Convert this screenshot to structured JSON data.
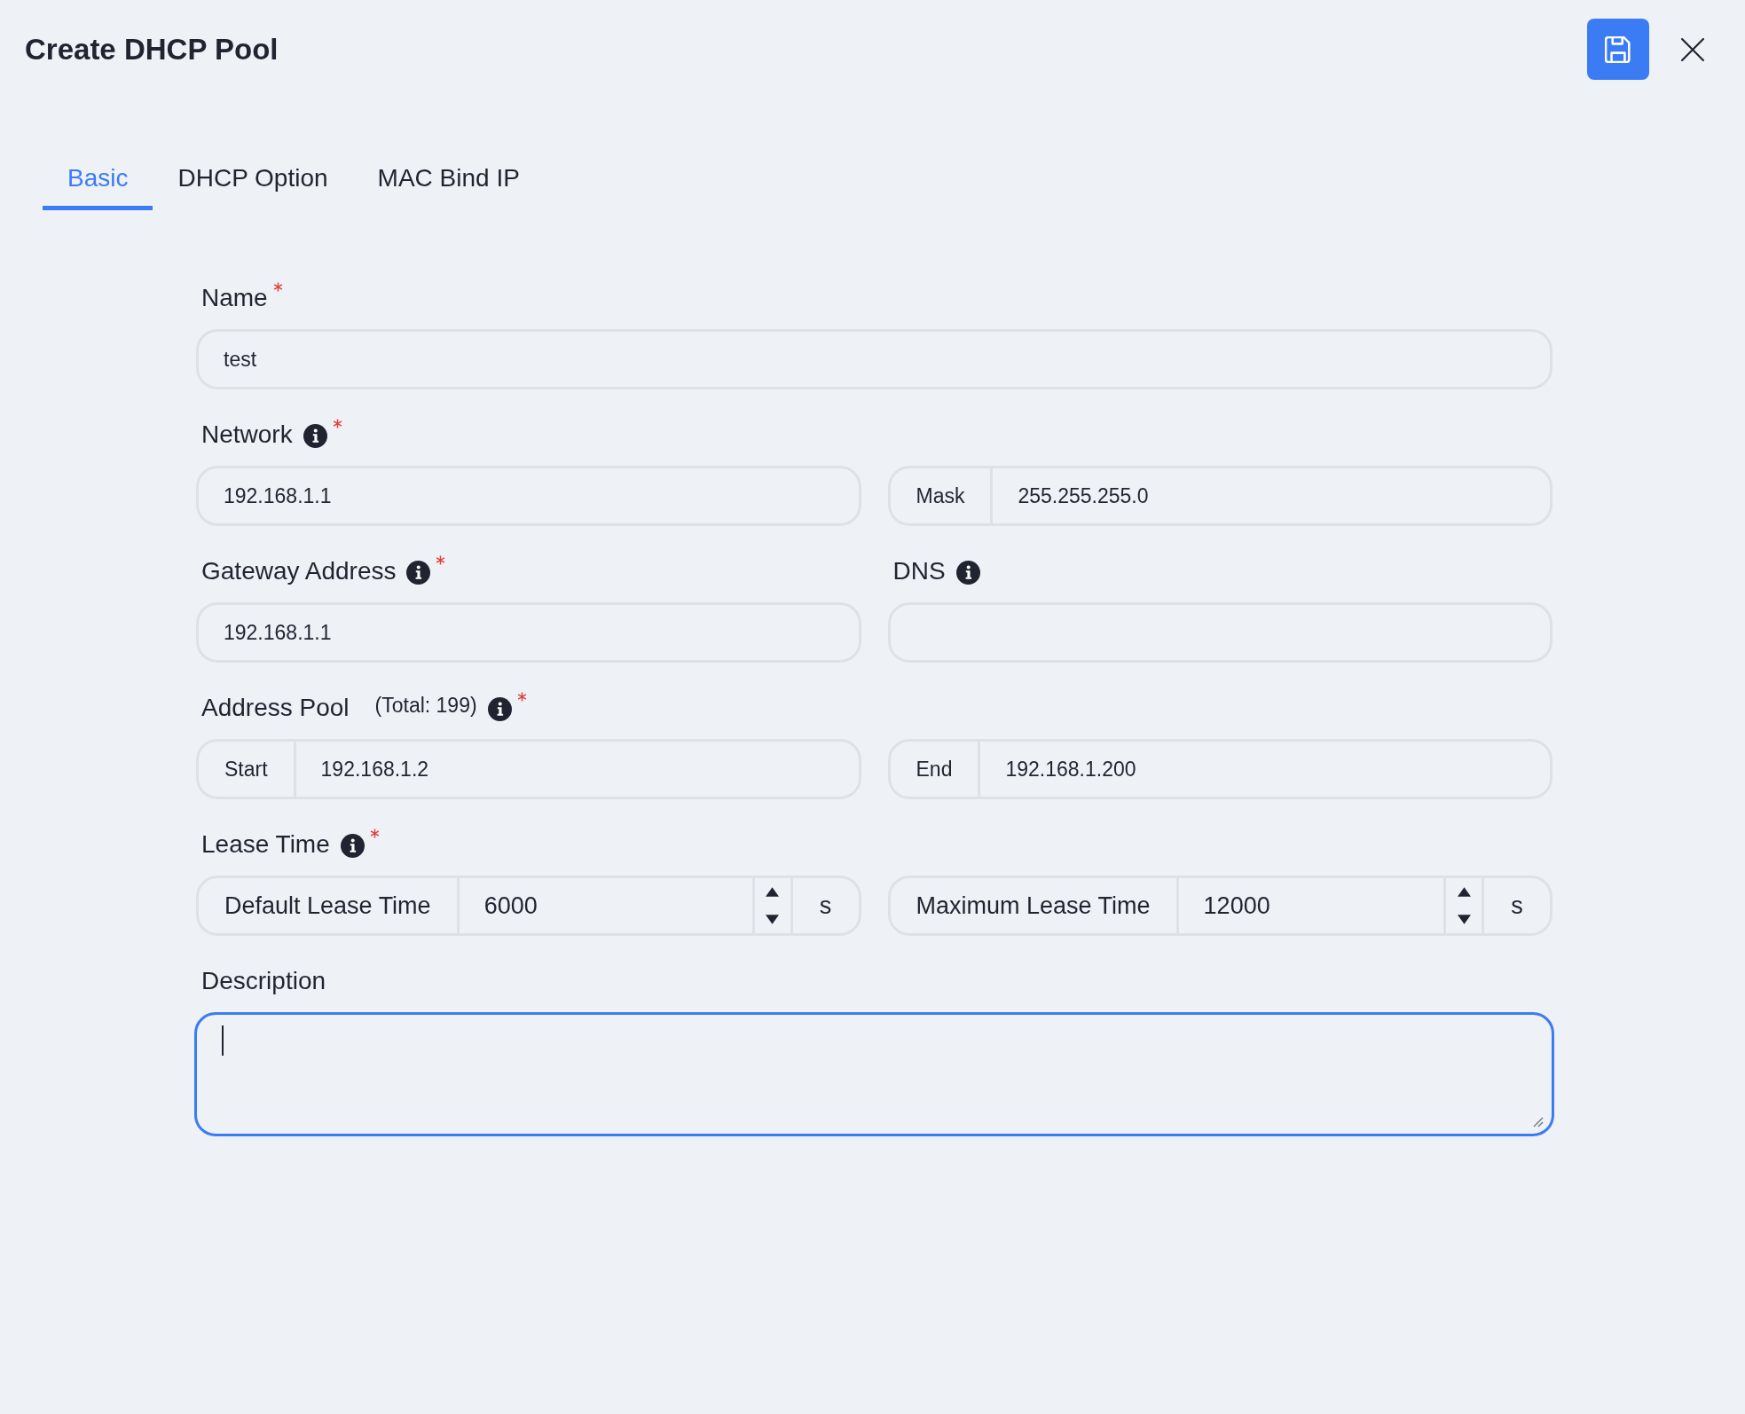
{
  "header": {
    "title": "Create DHCP Pool"
  },
  "tabs": [
    {
      "label": "Basic",
      "selected": true
    },
    {
      "label": "DHCP Option",
      "selected": false
    },
    {
      "label": "MAC Bind IP",
      "selected": false
    }
  ],
  "rows": [
    {
      "groups": [
        {
          "label": "Name",
          "info": false,
          "required": true,
          "controls": [
            {
              "kind": "text",
              "value": "test"
            }
          ]
        }
      ]
    },
    {
      "groups": [
        {
          "label": "Network",
          "info": true,
          "required": true,
          "controls": [
            {
              "kind": "text",
              "value": "192.168.1.1"
            },
            {
              "kind": "text",
              "addon": "Mask",
              "value": "255.255.255.0"
            }
          ]
        }
      ]
    },
    {
      "groups": [
        {
          "label": "Gateway Address",
          "info": true,
          "required": true,
          "controls": [
            {
              "kind": "text",
              "value": "192.168.1.1"
            }
          ]
        },
        {
          "label": "DNS",
          "info": true,
          "required": false,
          "controls": [
            {
              "kind": "text"
            }
          ]
        }
      ]
    },
    {
      "groups": [
        {
          "label": "Address Pool",
          "note": "(Total: 199)",
          "info": true,
          "required": true,
          "controls": [
            {
              "kind": "text",
              "addon": "Start",
              "value": "192.168.1.2"
            },
            {
              "kind": "text",
              "addon": "End",
              "value": "192.168.1.200"
            }
          ]
        }
      ]
    },
    {
      "groups": [
        {
          "label": "Lease Time",
          "info": true,
          "required": true,
          "controls": [
            {
              "kind": "number",
              "addon": "Default Lease Time",
              "value": "6000",
              "unit": "s"
            },
            {
              "kind": "number",
              "addon": "Maximum Lease Time",
              "value": "12000",
              "unit": "s"
            }
          ]
        }
      ]
    },
    {
      "groups": [
        {
          "label": "Description",
          "info": false,
          "required": false,
          "controls": [
            {
              "kind": "textarea",
              "focused": true
            }
          ]
        }
      ]
    }
  ]
}
